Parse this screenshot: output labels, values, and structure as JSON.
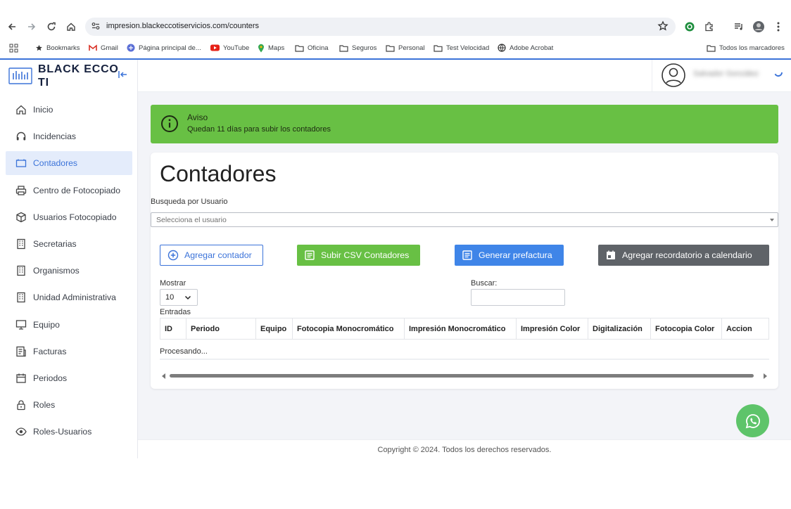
{
  "browser": {
    "url": "impresion.blackeccotiservicios.com/counters",
    "bookmarks": [
      {
        "label": "Bookmarks",
        "icon": "star-icon"
      },
      {
        "label": "Gmail",
        "icon": "gmail-icon"
      },
      {
        "label": "Página principal de...",
        "icon": "site-icon"
      },
      {
        "label": "YouTube",
        "icon": "youtube-icon"
      },
      {
        "label": "Maps",
        "icon": "maps-pin-icon"
      },
      {
        "label": "Oficina",
        "icon": "folder-icon"
      },
      {
        "label": "Seguros",
        "icon": "folder-icon"
      },
      {
        "label": "Personal",
        "icon": "folder-icon"
      },
      {
        "label": "Test Velocidad",
        "icon": "folder-icon"
      },
      {
        "label": "Adobe Acrobat",
        "icon": "globe-icon"
      }
    ],
    "all_bookmarks": "Todos los marcadores"
  },
  "brand": {
    "name": "BLACK ECCO TI"
  },
  "sidebar": {
    "items": [
      {
        "label": "Inicio",
        "icon": "home-icon"
      },
      {
        "label": "Incidencias",
        "icon": "headset-icon"
      },
      {
        "label": "Contadores",
        "icon": "counter-icon"
      },
      {
        "label": "Centro de Fotocopiado",
        "icon": "printer-icon"
      },
      {
        "label": "Usuarios Fotocopiado",
        "icon": "package-icon"
      },
      {
        "label": "Secretarias",
        "icon": "building-icon"
      },
      {
        "label": "Organismos",
        "icon": "building-icon"
      },
      {
        "label": "Unidad Administrativa",
        "icon": "building-icon"
      },
      {
        "label": "Equipo",
        "icon": "monitor-icon"
      },
      {
        "label": "Facturas",
        "icon": "invoice-icon"
      },
      {
        "label": "Periodos",
        "icon": "calendar-icon"
      },
      {
        "label": "Roles",
        "icon": "lock-icon"
      },
      {
        "label": "Roles-Usuarios",
        "icon": "eye-icon"
      }
    ],
    "active_index": 2
  },
  "header": {
    "user_name": "Salvador González"
  },
  "alert": {
    "title": "Aviso",
    "message": "Quedan 11 días para subir los contadores",
    "color": "#68c044"
  },
  "main": {
    "title": "Contadores",
    "user_search_label": "Busqueda por Usuario",
    "user_select_placeholder": "Selecciona el usuario",
    "buttons": {
      "add": "Agregar contador",
      "csv": "Subir CSV Contadores",
      "prefactura": "Generar prefactura",
      "calendar": "Agregar recordatorio a calendario"
    },
    "show_label": "Mostrar",
    "show_value": "10",
    "entries_label": "Entradas",
    "search_label": "Buscar:",
    "table": {
      "columns": [
        "ID",
        "Periodo",
        "Equipo",
        "Fotocopia Monocromático",
        "Impresión Monocromático",
        "Impresión Color",
        "Digitalización",
        "Fotocopia Color",
        "Accion"
      ]
    },
    "processing": "Procesando..."
  },
  "footer": {
    "copyright": "Copyright © 2024. Todos los derechos reservados."
  },
  "colors": {
    "accent": "#3b73d9",
    "success": "#68c044",
    "info": "#3f85e8",
    "dark": "#5f6368",
    "whatsapp": "#5ec46a"
  }
}
